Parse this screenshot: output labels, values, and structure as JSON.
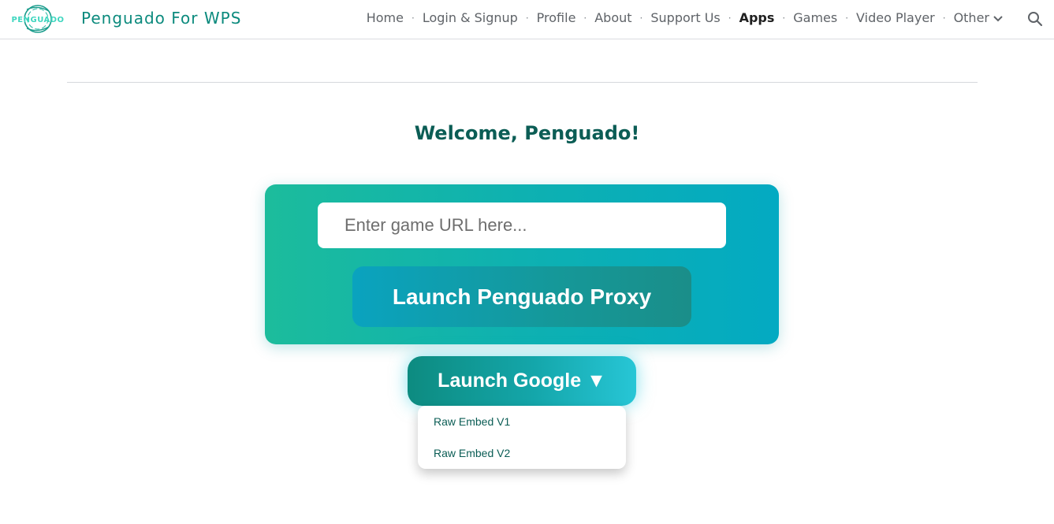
{
  "header": {
    "site_title": "Penguado For WPS",
    "logo_text": "PENGUADO",
    "nav": [
      {
        "label": "Home",
        "active": false
      },
      {
        "label": "Login & Signup",
        "active": false
      },
      {
        "label": "Profile",
        "active": false
      },
      {
        "label": "About",
        "active": false
      },
      {
        "label": "Support Us",
        "active": false
      },
      {
        "label": "Apps",
        "active": true
      },
      {
        "label": "Games",
        "active": false
      },
      {
        "label": "Video Player",
        "active": false
      },
      {
        "label": "Other",
        "active": false
      }
    ],
    "separator": "·",
    "search_icon": "search-icon"
  },
  "main": {
    "welcome": "Welcome, Penguado!",
    "url_placeholder": "Enter game URL here...",
    "url_value": "",
    "launch_proxy_label": "Launch Penguado Proxy",
    "launch_google_label": "Launch Google ▼",
    "dropdown_items": [
      "Raw Embed V1",
      "Raw Embed V2"
    ]
  },
  "colors": {
    "brand": "#0b8a7d",
    "heading": "#0b5d55",
    "card_gradient_start": "#1cbc9c",
    "card_gradient_end": "#03aac2"
  }
}
